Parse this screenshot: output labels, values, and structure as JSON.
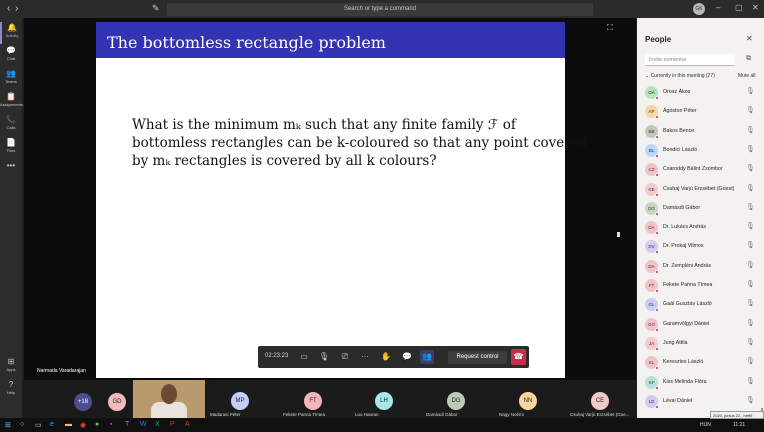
{
  "titlebar": {
    "back": "‹",
    "forward": "›",
    "search_placeholder": "Search or type a command",
    "user_initials": "GK",
    "minimize": "–",
    "maximize": "▢",
    "close": "✕"
  },
  "rail": {
    "items": [
      {
        "label": "Activity",
        "icon": "bell-icon",
        "glyph": "🔔"
      },
      {
        "label": "Chat",
        "icon": "chat-icon",
        "glyph": "💬"
      },
      {
        "label": "Teams",
        "icon": "teams-icon",
        "glyph": "👥"
      },
      {
        "label": "Assignments",
        "icon": "assignments-icon",
        "glyph": "📋"
      },
      {
        "label": "Calls",
        "icon": "phone-icon",
        "glyph": "📞"
      },
      {
        "label": "Files",
        "icon": "file-icon",
        "glyph": "📄"
      },
      {
        "label": "",
        "icon": "more-icon",
        "glyph": "•••"
      },
      {
        "label": "Apps",
        "icon": "apps-icon",
        "glyph": "⊞"
      },
      {
        "label": "Help",
        "icon": "help-icon",
        "glyph": "?"
      }
    ]
  },
  "slide": {
    "title": "The bottomless rectangle problem",
    "line1": "What is the minimum mₖ such that any finite family ℱ of",
    "line2": "bottomless rectangles can be k-coloured so that any point covered",
    "line3": "by mₖ rectangles is covered by all k colours?"
  },
  "presenter_name": "Narmada Varadarajan",
  "callbar": {
    "timer": "02:23:23",
    "request_control": "Request control"
  },
  "strip": {
    "overflow_count": "+18",
    "participants": [
      {
        "initials": "GD",
        "name": "",
        "color": "#f1bbbc"
      },
      {
        "initials": "MP",
        "name": "Madarasi Péter",
        "color": "#c5cbfa"
      },
      {
        "initials": "FT",
        "name": "Fekete Panna Tímea",
        "color": "#f4b6b8"
      },
      {
        "initials": "LH",
        "name": "Luo Haoran",
        "color": "#a6e9ed"
      },
      {
        "initials": "DG",
        "name": "Damásdi Gábor",
        "color": "#bdc9b1"
      },
      {
        "initials": "NN",
        "name": "Nagy Noémi",
        "color": "#fcd59c"
      },
      {
        "initials": "CE",
        "name": "Csuhaj Varjú Erzsébet (Gue...",
        "color": "#f0c9c9"
      }
    ]
  },
  "people": {
    "title": "People",
    "invite_placeholder": "Invite someone",
    "section_label": "Currently in this meeting (27)",
    "mute_all": "Mute all",
    "members": [
      {
        "initials": "OÁ",
        "name": "Orosz Ákos",
        "color": "#b6e3b7"
      },
      {
        "initials": "ÁP",
        "name": "Ágoston Péter",
        "color": "#fbd4a4"
      },
      {
        "initials": "BB",
        "name": "Bakos Bence",
        "color": "#bfc9b8"
      },
      {
        "initials": "BL",
        "name": "Bondici László",
        "color": "#b9d7f5"
      },
      {
        "initials": "CZ",
        "name": "Csaroddy Bálint Zsombor",
        "color": "#f6c1c6"
      },
      {
        "initials": "CE",
        "name": "Csuhaj Varjú Erzsébet (Guest)",
        "color": "#f6c9cc"
      },
      {
        "initials": "DG",
        "name": "Damásdi Gábor",
        "color": "#c9d8bc"
      },
      {
        "initials": "DA",
        "name": "Dr. Lukács András",
        "color": "#f6c1c6"
      },
      {
        "initials": "DV",
        "name": "Dr. Prokaj Vilmos",
        "color": "#d6c9f0"
      },
      {
        "initials": "DA",
        "name": "Dr. Zempléni András",
        "color": "#f6c1c6"
      },
      {
        "initials": "FT",
        "name": "Fekete Panna Tímea",
        "color": "#f6c1c6"
      },
      {
        "initials": "GL",
        "name": "Gaál Gusztáv László",
        "color": "#c9cdf3"
      },
      {
        "initials": "GO",
        "name": "Garamvölgyi Dániel",
        "color": "#f6c1c6"
      },
      {
        "initials": "JA",
        "name": "Jung Attila",
        "color": "#f6c9cc"
      },
      {
        "initials": "KL",
        "name": "Keresztes László",
        "color": "#f6c1c6"
      },
      {
        "initials": "KF",
        "name": "Kiss Melinda Flóra",
        "color": "#b6e0d9"
      },
      {
        "initials": "LD",
        "name": "Lévai Dániel",
        "color": "#d6c9f0"
      }
    ]
  },
  "taskbar": {
    "lang": "HUN",
    "time": "11:21",
    "tooltip": "2020. június 22., hétfő"
  }
}
